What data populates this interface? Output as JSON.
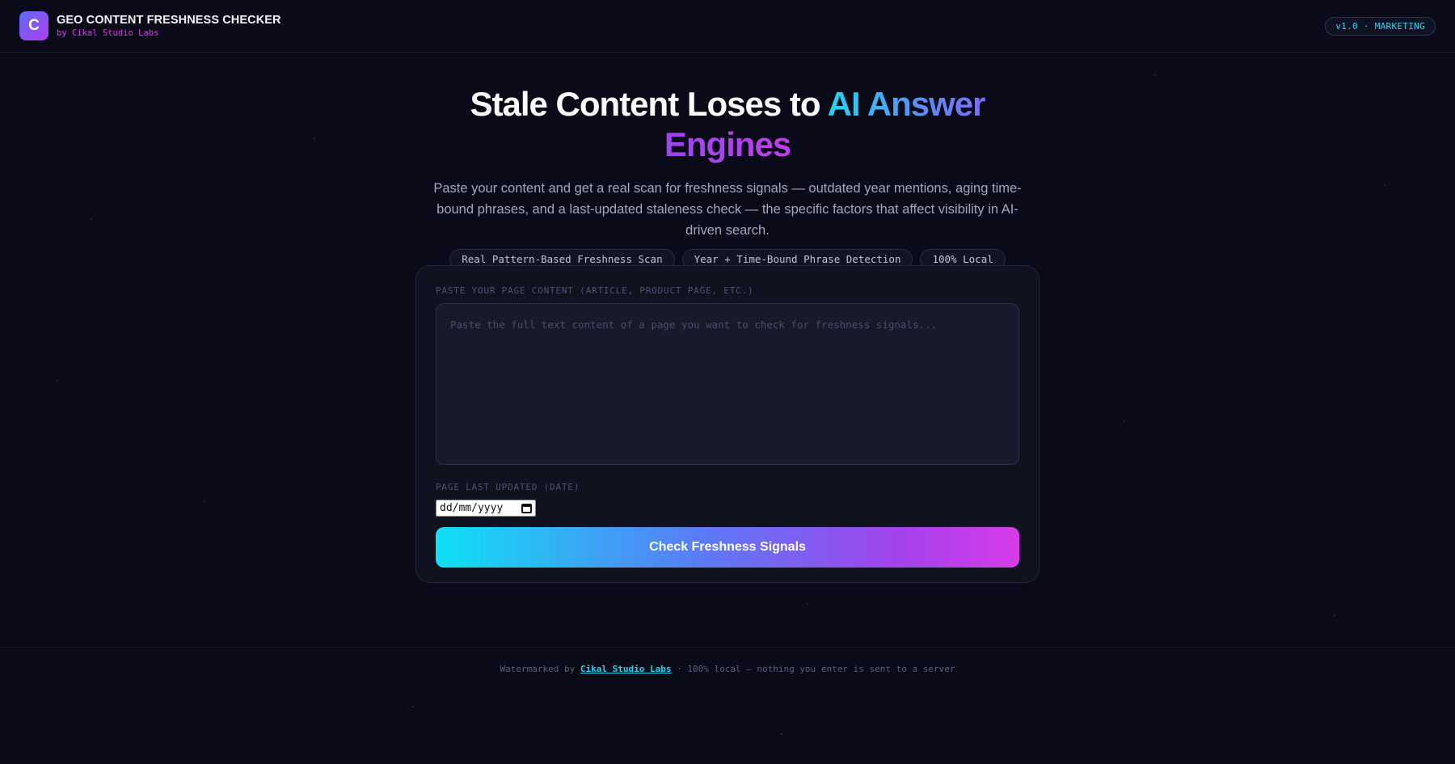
{
  "header": {
    "logo_letter": "C",
    "title": "GEO CONTENT FRESHNESS CHECKER",
    "subtitle": "by Cikal Studio Labs",
    "version_badge": "v1.0 · MARKETING"
  },
  "hero": {
    "headline_plain": "Stale Content Loses to ",
    "headline_accent_1": "AI Answer",
    "headline_accent_2": "Engines",
    "description": "Paste your content and get a real scan for freshness signals — outdated year mentions, aging time-bound phrases, and a last-updated staleness check — the specific factors that affect visibility in AI-driven search.",
    "chips": [
      "Real Pattern-Based Freshness Scan",
      "Year + Time-Bound Phrase Detection",
      "100% Local"
    ]
  },
  "form": {
    "content_label": "PASTE YOUR PAGE CONTENT (ARTICLE, PRODUCT PAGE, ETC.)",
    "content_placeholder": "Paste the full text content of a page you want to check for freshness signals...",
    "date_label": "PAGE LAST UPDATED (DATE)",
    "date_placeholder": "dd/mm/yyyy",
    "submit_label": "Check Freshness Signals"
  },
  "footer": {
    "prefix": "Watermarked by ",
    "link_text": "Cikal Studio Labs",
    "suffix": " · 100% local — nothing you enter is sent to a server"
  },
  "colors": {
    "background": "#0a0a18",
    "accent_cyan": "#1fd6f0",
    "accent_magenta": "#d83ce8",
    "accent_purple": "#9b45ef"
  }
}
